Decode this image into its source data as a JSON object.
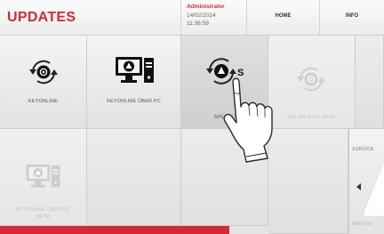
{
  "header": {
    "title": "UPDATES",
    "user": "Administrator",
    "date": "14/02/2014",
    "time": "11:36:59",
    "home_label": "HOME",
    "info_label": "INFO"
  },
  "tiles": [
    {
      "label": "KEYONLINE",
      "icon": "keyonline-icon",
      "state": "normal"
    },
    {
      "label": "KEYONLINE ÜBER PC",
      "icon": "computer-icon",
      "state": "normal"
    },
    {
      "label": "SPEZIAL",
      "icon": "special-update-icon",
      "state": "pressed"
    },
    {
      "label": "ONLINE FULL BETA",
      "icon": "keyonline-icon",
      "state": "disabled"
    },
    {
      "label": "KEYONLINE ÜBER PC BETA",
      "icon": "computer-icon",
      "state": "disabled"
    }
  ],
  "side": {
    "back_label": "ZURÜCK",
    "next_label": "WEITER"
  },
  "colors": {
    "accent": "#d42a35"
  }
}
